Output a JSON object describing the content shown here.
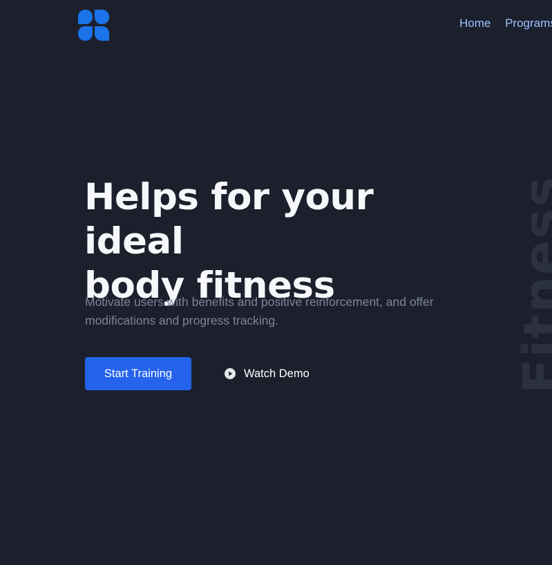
{
  "nav": {
    "items": [
      {
        "label": "Home"
      },
      {
        "label": "Programs"
      }
    ]
  },
  "hero": {
    "title_line1": "Helps for your ideal",
    "title_line2": "body fitness",
    "subtitle": "Motivate users with benefits and positive reinforcement, and offer modifications and progress tracking.",
    "primary_button": "Start Training",
    "secondary_button": "Watch Demo",
    "watermark": "Fitness"
  },
  "colors": {
    "background": "#1c202c",
    "accent": "#2563eb",
    "logo": "#1a73e8",
    "nav_link": "#9cc3ff",
    "subtitle": "#7c8597",
    "watermark": "#2c3140"
  },
  "icons": {
    "logo": "four-petal-logo-icon",
    "play": "play-circle-icon"
  }
}
